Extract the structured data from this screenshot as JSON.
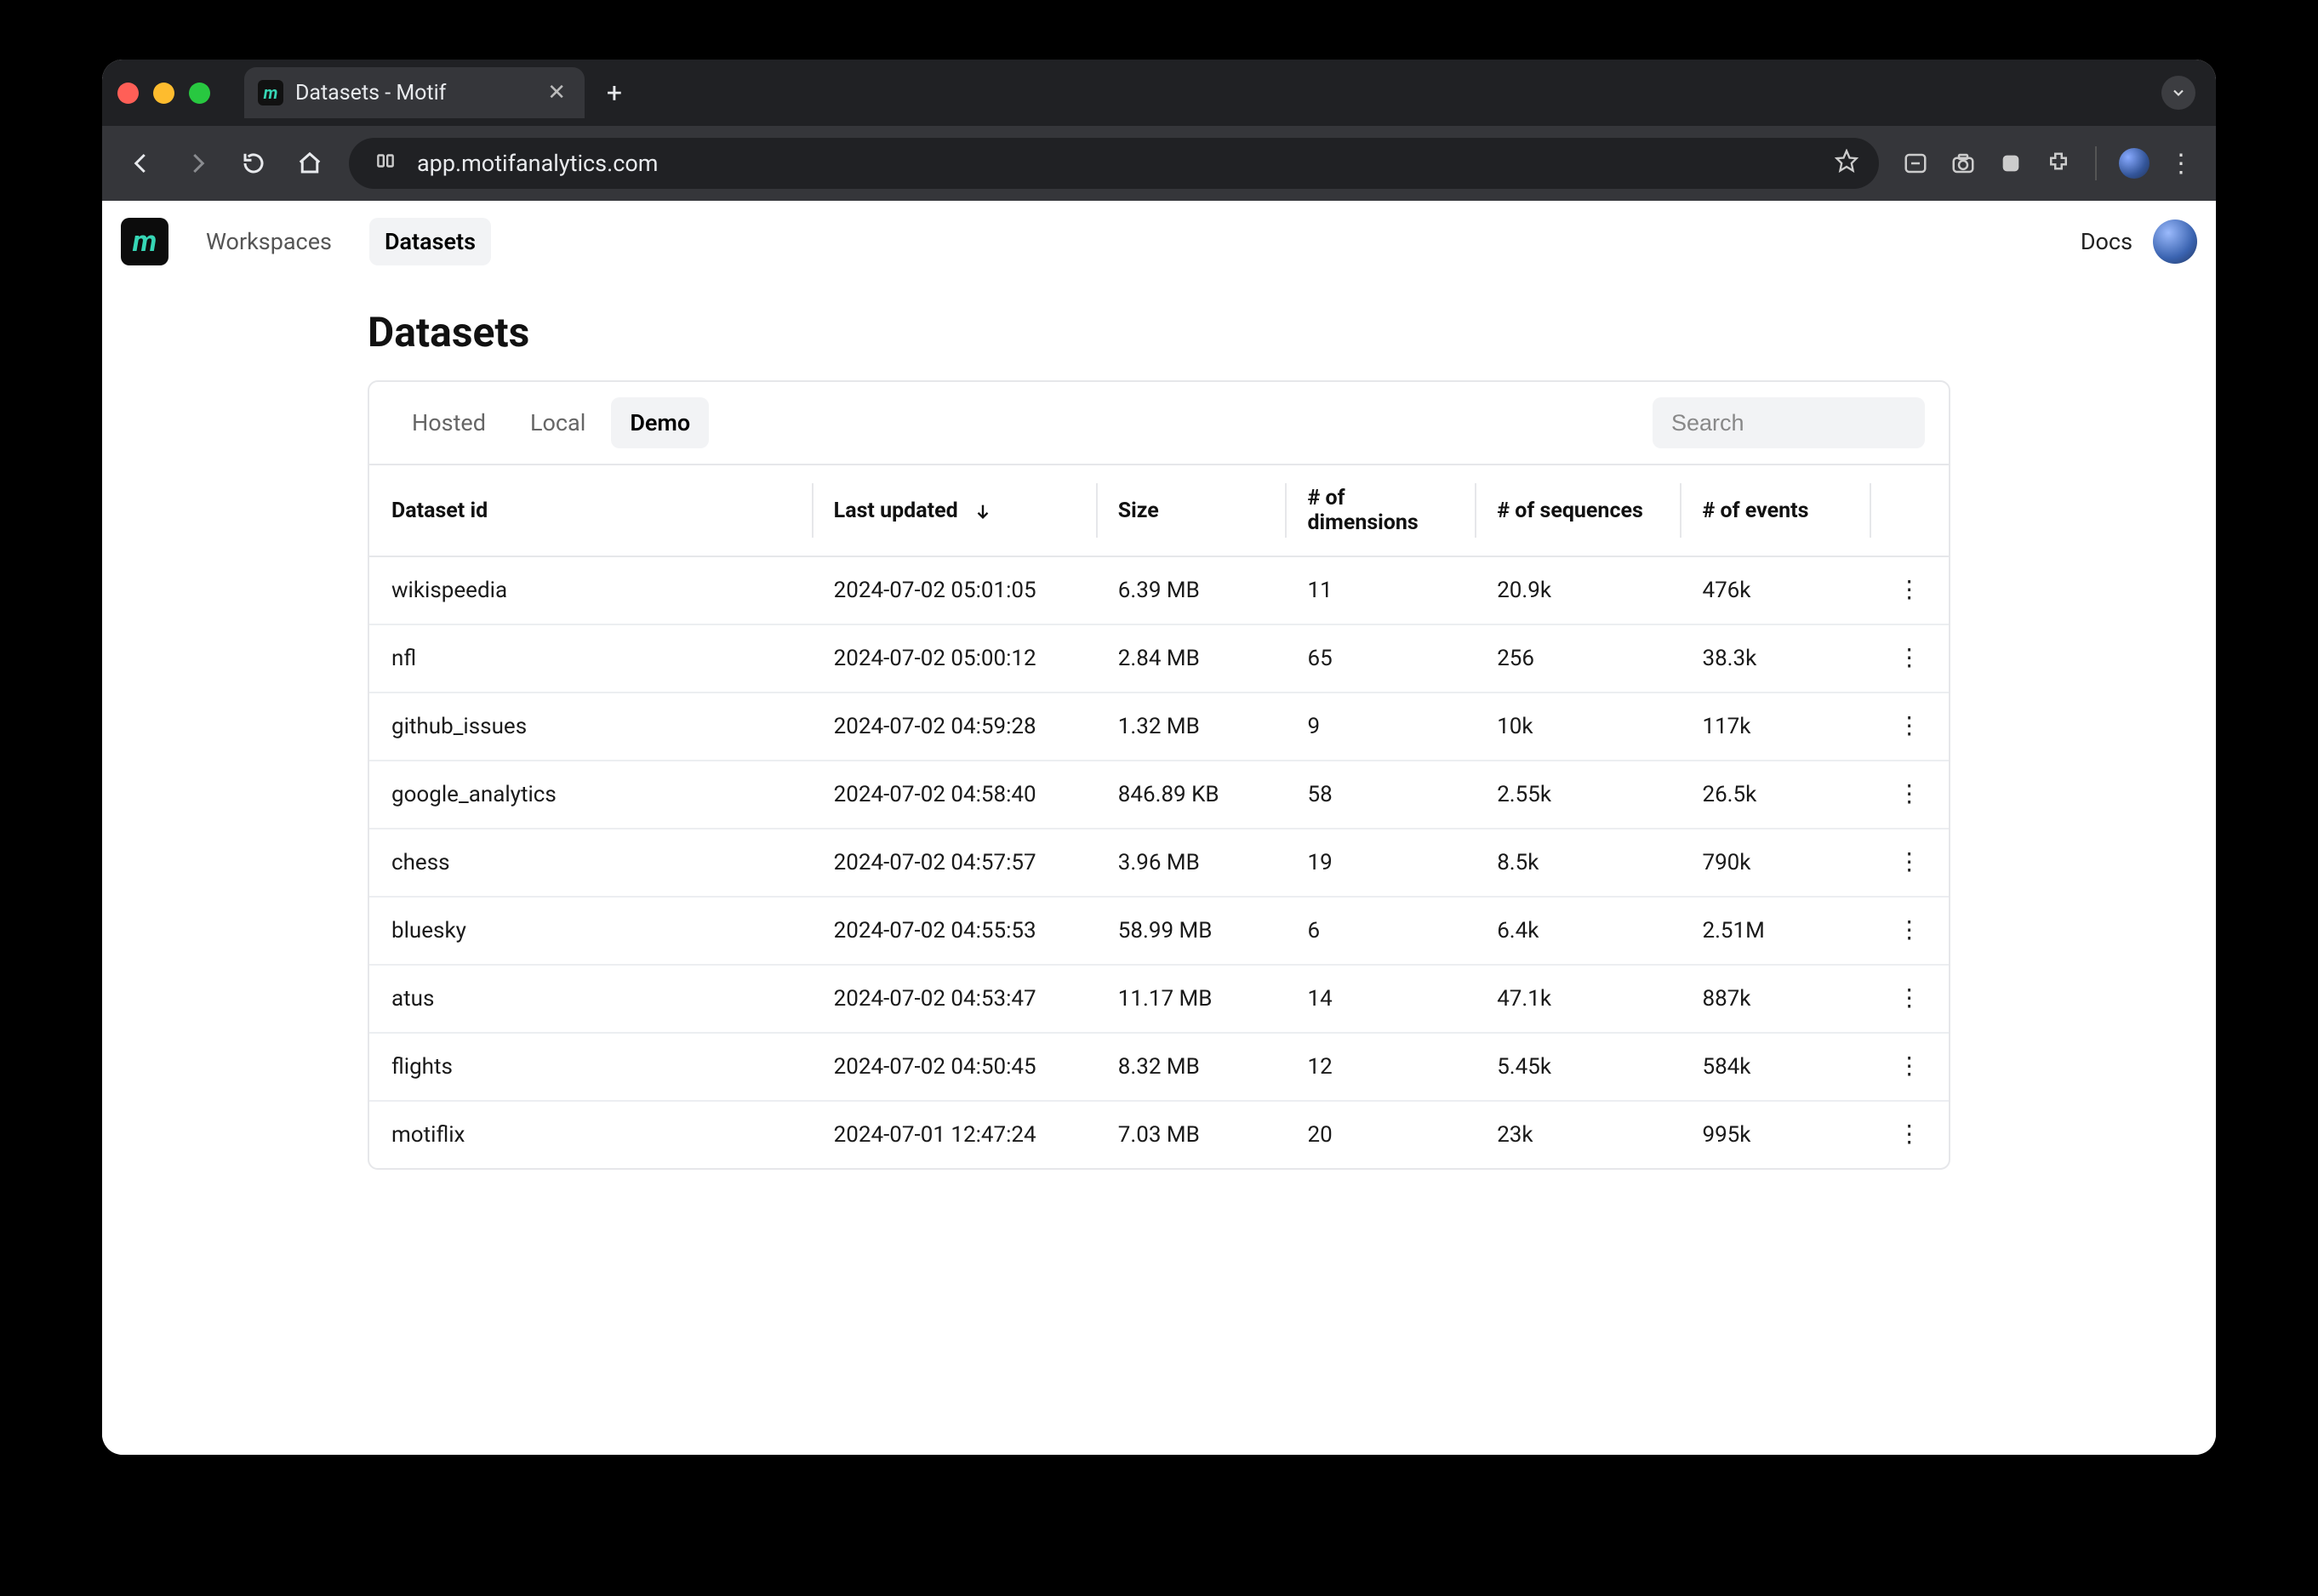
{
  "browser": {
    "tab_title": "Datasets - Motif",
    "url": "app.motifanalytics.com"
  },
  "header": {
    "nav": {
      "workspaces": "Workspaces",
      "datasets": "Datasets"
    },
    "docs": "Docs"
  },
  "page": {
    "title": "Datasets",
    "tabs": {
      "hosted": "Hosted",
      "local": "Local",
      "demo": "Demo"
    },
    "search_placeholder": "Search",
    "columns": {
      "id": "Dataset id",
      "updated": "Last updated",
      "size": "Size",
      "dimensions": "# of dimensions",
      "sequences": "# of sequences",
      "events": "# of events"
    },
    "rows": [
      {
        "id": "wikispeedia",
        "updated": "2024-07-02 05:01:05",
        "size": "6.39 MB",
        "dimensions": "11",
        "sequences": "20.9k",
        "events": "476k"
      },
      {
        "id": "nfl",
        "updated": "2024-07-02 05:00:12",
        "size": "2.84 MB",
        "dimensions": "65",
        "sequences": "256",
        "events": "38.3k"
      },
      {
        "id": "github_issues",
        "updated": "2024-07-02 04:59:28",
        "size": "1.32 MB",
        "dimensions": "9",
        "sequences": "10k",
        "events": "117k"
      },
      {
        "id": "google_analytics",
        "updated": "2024-07-02 04:58:40",
        "size": "846.89 KB",
        "dimensions": "58",
        "sequences": "2.55k",
        "events": "26.5k"
      },
      {
        "id": "chess",
        "updated": "2024-07-02 04:57:57",
        "size": "3.96 MB",
        "dimensions": "19",
        "sequences": "8.5k",
        "events": "790k"
      },
      {
        "id": "bluesky",
        "updated": "2024-07-02 04:55:53",
        "size": "58.99 MB",
        "dimensions": "6",
        "sequences": "6.4k",
        "events": "2.51M"
      },
      {
        "id": "atus",
        "updated": "2024-07-02 04:53:47",
        "size": "11.17 MB",
        "dimensions": "14",
        "sequences": "47.1k",
        "events": "887k"
      },
      {
        "id": "flights",
        "updated": "2024-07-02 04:50:45",
        "size": "8.32 MB",
        "dimensions": "12",
        "sequences": "5.45k",
        "events": "584k"
      },
      {
        "id": "motiflix",
        "updated": "2024-07-01 12:47:24",
        "size": "7.03 MB",
        "dimensions": "20",
        "sequences": "23k",
        "events": "995k"
      }
    ]
  }
}
